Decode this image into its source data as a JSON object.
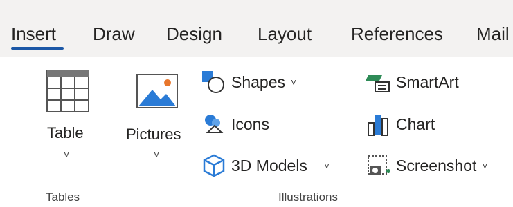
{
  "tabs": [
    {
      "label": "Insert",
      "active": true
    },
    {
      "label": "Draw"
    },
    {
      "label": "Design"
    },
    {
      "label": "Layout"
    },
    {
      "label": "References"
    },
    {
      "label": "Mail"
    }
  ],
  "groups": {
    "tables": {
      "label": "Tables",
      "table_button": {
        "label": "Table",
        "icon": "table-icon",
        "dropdown": "˅"
      }
    },
    "illustrations": {
      "label": "Illustrations",
      "pictures_button": {
        "label": "Pictures",
        "icon": "picture-icon",
        "dropdown": "˅"
      },
      "shapes": {
        "label": "Shapes",
        "icon": "shapes-icon",
        "dropdown": "˅"
      },
      "icons": {
        "label": "Icons",
        "icon": "icons-icon"
      },
      "models3d": {
        "label": "3D Models",
        "icon": "3d-model-icon",
        "dropdown": "˅"
      },
      "smartart": {
        "label": "SmartArt",
        "icon": "smartart-icon"
      },
      "chart": {
        "label": "Chart",
        "icon": "chart-icon"
      },
      "screenshot": {
        "label": "Screenshot",
        "icon": "screenshot-icon",
        "dropdown": "˅"
      }
    }
  },
  "colors": {
    "accent": "#1b57a6",
    "icon_blue": "#1f6fc1",
    "icon_green": "#2e8b57",
    "tabbar_bg": "#f3f2f1"
  }
}
